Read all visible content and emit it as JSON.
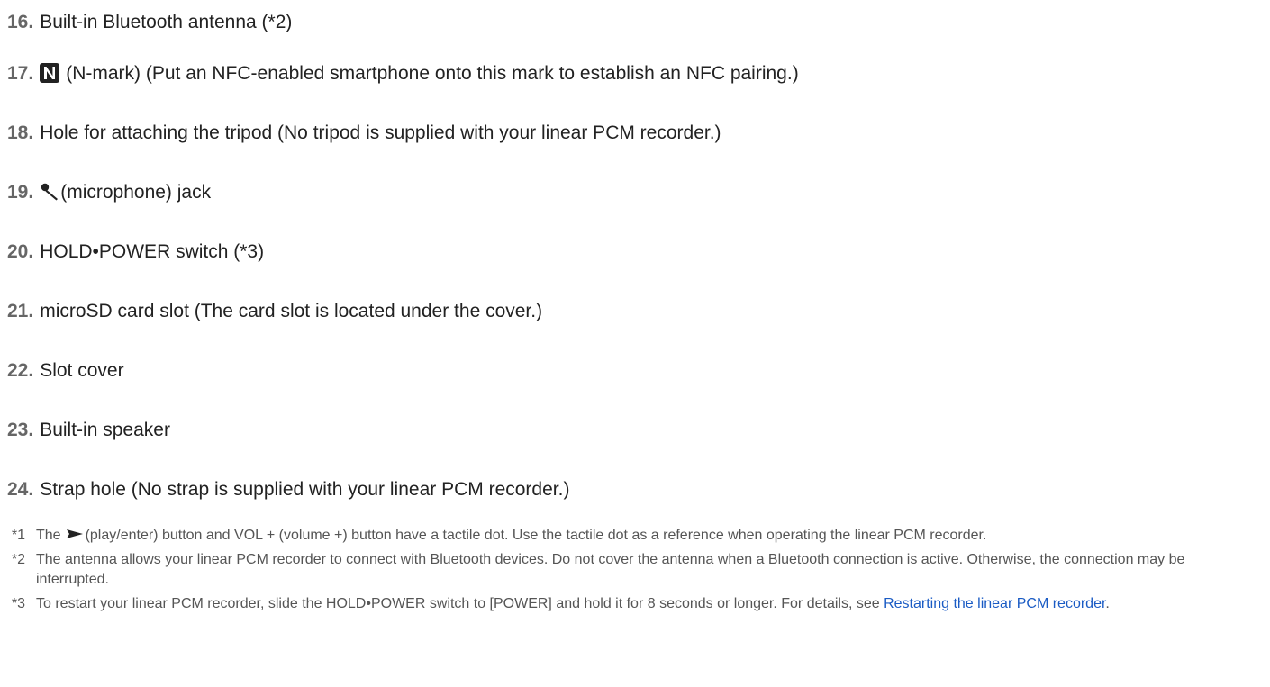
{
  "parts": [
    {
      "num": "16.",
      "desc": "Built-in Bluetooth antenna (*2)"
    },
    {
      "num": "17.",
      "icon": "n-mark-icon",
      "desc": "(N-mark) (Put an NFC-enabled smartphone onto this mark to establish an NFC pairing.)"
    },
    {
      "num": "18.",
      "desc": "Hole for attaching the tripod (No tripod is supplied with your linear PCM recorder.)"
    },
    {
      "num": "19.",
      "icon": "microphone-icon",
      "desc": "(microphone) jack"
    },
    {
      "num": "20.",
      "desc": "HOLD•POWER switch (*3)"
    },
    {
      "num": "21.",
      "desc": "microSD card slot (The card slot is located under the cover.)"
    },
    {
      "num": "22.",
      "desc": "Slot cover"
    },
    {
      "num": "23.",
      "desc": "Built-in speaker"
    },
    {
      "num": "24.",
      "desc": "Strap hole (No strap is supplied with your linear PCM recorder.)"
    }
  ],
  "notes": [
    {
      "mark": "*1",
      "before_icon": "The",
      "icon": "play-icon",
      "after_icon": "(play/enter) button and VOL + (volume +) button have a tactile dot. Use the tactile dot as a reference when operating the linear PCM recorder."
    },
    {
      "mark": "*2",
      "text": "The antenna allows your linear PCM recorder to connect with Bluetooth devices. Do not cover the antenna when a Bluetooth connection is active. Otherwise, the connection may be interrupted."
    },
    {
      "mark": "*3",
      "text": "To restart your linear PCM recorder, slide the HOLD•POWER switch to [POWER] and hold it for 8 seconds or longer. For details, see",
      "link_text": "Restarting the linear PCM recorder",
      "after_link": "."
    }
  ],
  "colors": {
    "number": "#666666",
    "text": "#222222",
    "note_text": "#555555",
    "link": "#1a5bc4"
  }
}
